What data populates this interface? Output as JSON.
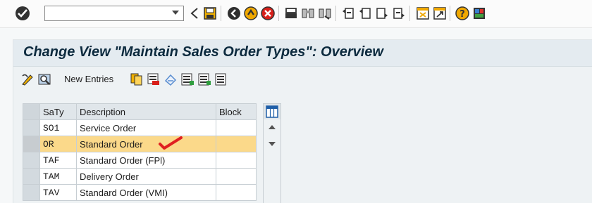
{
  "toolbar": {
    "command_field": {
      "value": "",
      "placeholder": ""
    },
    "icons": [
      "enter-icon",
      "back-icon",
      "save-icon",
      "back-nav-icon",
      "exit-icon",
      "cancel-icon",
      "print-icon",
      "find-icon",
      "find-next-icon",
      "first-page-icon",
      "previous-page-icon",
      "next-page-icon",
      "last-page-icon",
      "create-session-icon",
      "shortcut-icon",
      "help-icon",
      "customize-layout-icon"
    ]
  },
  "screen": {
    "title": "Change View \"Maintain Sales Order Types\": Overview"
  },
  "app_toolbar": {
    "new_entries_label": "New Entries",
    "icons": [
      "display-change-icon",
      "other-view-icon",
      "copy-as-icon",
      "delete-icon",
      "undo-change-icon",
      "select-all-icon",
      "select-block-icon",
      "deselect-all-icon"
    ]
  },
  "table": {
    "columns": [
      "SaTy",
      "Description",
      "Block"
    ],
    "rows": [
      {
        "code": "SO1",
        "description": "Service Order",
        "block": "",
        "highlighted": false
      },
      {
        "code": "OR",
        "description": "Standard Order",
        "block": "",
        "highlighted": true
      },
      {
        "code": "TAF",
        "description": "Standard Order (FPl)",
        "block": "",
        "highlighted": false
      },
      {
        "code": "TAM",
        "description": "Delivery Order",
        "block": "",
        "highlighted": false
      },
      {
        "code": "TAV",
        "description": "Standard Order (VMI)",
        "block": "",
        "highlighted": false
      }
    ]
  },
  "colors": {
    "highlight_row": "#fbd98a",
    "title_text": "#0c2a3e",
    "annotation_check": "#e02020"
  }
}
